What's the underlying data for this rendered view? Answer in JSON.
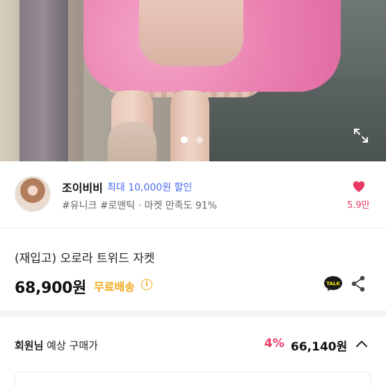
{
  "hero": {
    "carousel_total": 2,
    "carousel_index": 1,
    "icons": {
      "expand": "expand-icon"
    }
  },
  "seller": {
    "name": "조이비비",
    "promo": "최대 10,000원 할인",
    "tags": "#유니크 #로맨틱 · 마켓 만족도 91%",
    "like_count": "5.9만",
    "colors": {
      "promo": "#4a6cf0",
      "like": "#e83b64"
    }
  },
  "product": {
    "title": "(재입고) 오로라 트위드 자켓",
    "price": "68,900원",
    "shipping": "무료배송",
    "info_glyph": "i",
    "talk_label": "TALK",
    "colors": {
      "shipping": "#f2a81c"
    }
  },
  "member": {
    "label_bold": "회원님",
    "label_rest": " 예상 구매가",
    "discount": "4%",
    "price": "66,140원",
    "colors": {
      "discount": "#e83b64"
    }
  }
}
